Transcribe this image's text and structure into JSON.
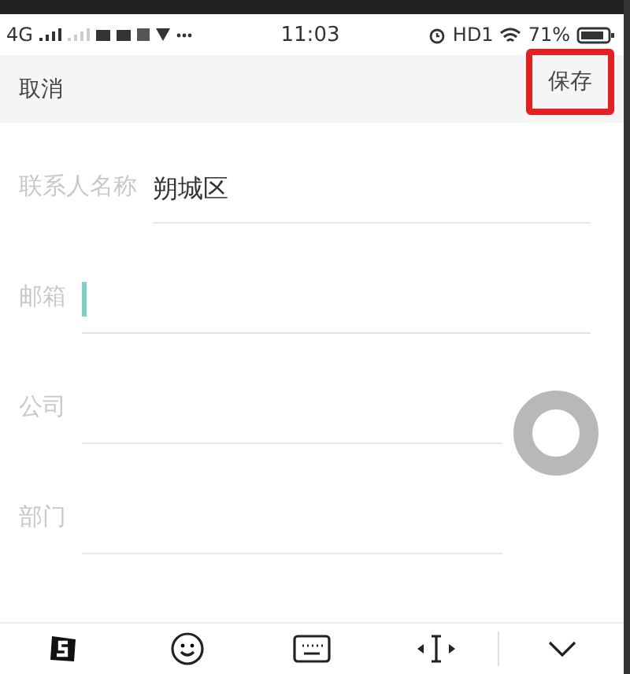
{
  "status_bar": {
    "network": "4G",
    "time": "11:03",
    "hd": "HD1",
    "battery": "71%"
  },
  "header": {
    "cancel": "取消",
    "save": {
      "label": "保存",
      "highlighted": true
    }
  },
  "fields": [
    {
      "label": "联系人名称",
      "value": "朔城区",
      "focused": false
    },
    {
      "label": "邮箱",
      "focused": true
    },
    {
      "label": "公司",
      "focused": false
    },
    {
      "label": "部门",
      "focused": false
    }
  ],
  "keyboard_toolbar": {
    "items": [
      {
        "kind": "logo"
      },
      {
        "kind": "emoji"
      },
      {
        "kind": "keyboard"
      },
      {
        "kind": "cursor"
      },
      {
        "kind": "collapse"
      }
    ]
  }
}
